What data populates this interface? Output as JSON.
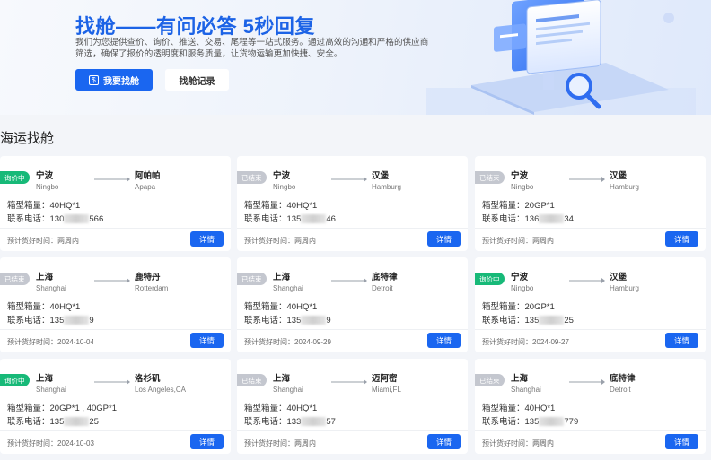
{
  "banner": {
    "title": "找舱——有问必答 5秒回复",
    "description": "我们为您提供查价、询价、推送、交易、尾程等一站式服务。通过高效的沟通和严格的供应商筛选，确保了报价的透明度和服务质量，让货物运输更加快捷、安全。",
    "primary_button": "我要找舱",
    "primary_icon": "$",
    "secondary_button": "找舱记录"
  },
  "section": {
    "title": "海运找舱"
  },
  "labels": {
    "container": "箱型箱量：",
    "phone": "联系电话：",
    "estimate": "预计货好时间：",
    "detail": "详情"
  },
  "colors": {
    "accent": "#1a66f0",
    "active_badge": "#17b978",
    "closed_badge": "#c4c7cf"
  },
  "cards": [
    {
      "status": "询价中",
      "status_type": "active",
      "from_zh": "宁波",
      "from_en": "Ningbo",
      "to_zh": "阿帕帕",
      "to_en": "Apapa",
      "container": "40HQ*1",
      "phone_pre": "130",
      "phone_post": "566",
      "estimate": "两周内"
    },
    {
      "status": "已结束",
      "status_type": "closed",
      "from_zh": "宁波",
      "from_en": "Ningbo",
      "to_zh": "汉堡",
      "to_en": "Hamburg",
      "container": "40HQ*1",
      "phone_pre": "135",
      "phone_post": "46",
      "estimate": "两周内"
    },
    {
      "status": "已结束",
      "status_type": "closed",
      "from_zh": "宁波",
      "from_en": "Ningbo",
      "to_zh": "汉堡",
      "to_en": "Hamburg",
      "container": "20GP*1",
      "phone_pre": "136",
      "phone_post": "34",
      "estimate": "两周内"
    },
    {
      "status": "已结束",
      "status_type": "closed",
      "from_zh": "上海",
      "from_en": "Shanghai",
      "to_zh": "鹿特丹",
      "to_en": "Rotterdam",
      "container": "40HQ*1",
      "phone_pre": "135",
      "phone_post": "9",
      "estimate": "2024-10-04"
    },
    {
      "status": "已结束",
      "status_type": "closed",
      "from_zh": "上海",
      "from_en": "Shanghai",
      "to_zh": "底特律",
      "to_en": "Detroit",
      "container": "40HQ*1",
      "phone_pre": "135",
      "phone_post": "9",
      "estimate": "2024-09-29"
    },
    {
      "status": "询价中",
      "status_type": "active",
      "from_zh": "宁波",
      "from_en": "Ningbo",
      "to_zh": "汉堡",
      "to_en": "Hamburg",
      "container": "20GP*1",
      "phone_pre": "135",
      "phone_post": "25",
      "estimate": "2024-09-27"
    },
    {
      "status": "询价中",
      "status_type": "active",
      "from_zh": "上海",
      "from_en": "Shanghai",
      "to_zh": "洛杉矶",
      "to_en": "Los Angeles,CA",
      "container": "20GP*1 , 40GP*1",
      "phone_pre": "135",
      "phone_post": "25",
      "estimate": "2024-10-03"
    },
    {
      "status": "已结束",
      "status_type": "closed",
      "from_zh": "上海",
      "from_en": "Shanghai",
      "to_zh": "迈阿密",
      "to_en": "Miami,FL",
      "container": "40HQ*1",
      "phone_pre": "133",
      "phone_post": "57",
      "estimate": "两周内"
    },
    {
      "status": "已结束",
      "status_type": "closed",
      "from_zh": "上海",
      "from_en": "Shanghai",
      "to_zh": "底特律",
      "to_en": "Detroit",
      "container": "40HQ*1",
      "phone_pre": "135",
      "phone_post": "779",
      "estimate": "两周内"
    }
  ]
}
